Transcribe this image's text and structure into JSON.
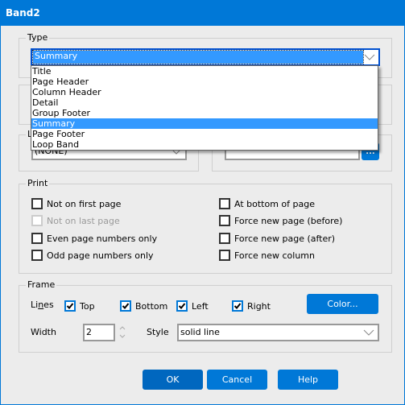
{
  "window": {
    "title": "Band2"
  },
  "type_group": {
    "label": "Type",
    "selected": "Summary",
    "options": [
      "Title",
      "Page Header",
      "Column Header",
      "Detail",
      "Group Footer",
      "Summary",
      "Page Footer",
      "Loop Band"
    ],
    "selected_index": 5
  },
  "link_group": {
    "label_visible": "L",
    "combo_value": "(NONE)"
  },
  "right_mid_group": {
    "textbox_value": "",
    "browse_button": "..."
  },
  "print_group": {
    "label": "Print",
    "left_options": [
      {
        "label": "Not on first page",
        "checked": false,
        "enabled": true
      },
      {
        "label": "Not on last page",
        "checked": false,
        "enabled": false
      },
      {
        "label": "Even page numbers only",
        "checked": false,
        "enabled": true
      },
      {
        "label": "Odd page numbers only",
        "checked": false,
        "enabled": true
      }
    ],
    "right_options": [
      {
        "label": "At bottom of page",
        "checked": false,
        "enabled": true
      },
      {
        "label": "Force new page (before)",
        "checked": false,
        "enabled": true
      },
      {
        "label": "Force new page (after)",
        "checked": false,
        "enabled": true
      },
      {
        "label": "Force new column",
        "checked": false,
        "enabled": true
      }
    ]
  },
  "frame_group": {
    "label": "Frame",
    "lines_label_pre": "Li",
    "lines_label_u": "n",
    "lines_label_post": "es",
    "lines": [
      {
        "label": "Top",
        "checked": true
      },
      {
        "label": "Bottom",
        "checked": true
      },
      {
        "label": "Left",
        "checked": true
      },
      {
        "label": "Right",
        "checked": true
      }
    ],
    "color_button": "Color...",
    "width_label": "Width",
    "width_value": "2",
    "style_label": "Style",
    "style_value": "solid line"
  },
  "buttons": {
    "ok": "OK",
    "cancel": "Cancel",
    "help": "Help"
  },
  "colors": {
    "accent": "#0078d7",
    "selection": "#3399ff"
  }
}
